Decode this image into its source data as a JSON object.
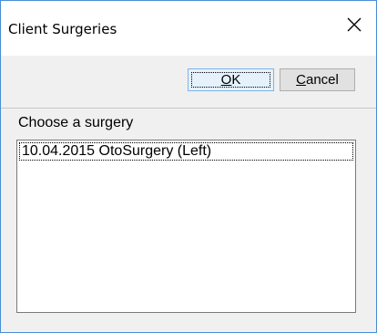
{
  "window": {
    "title": "Client Surgeries",
    "close_icon": "close-icon"
  },
  "toolbar": {
    "ok_label_mnemonic": "O",
    "ok_label_rest": "K",
    "cancel_label_mnemonic": "C",
    "cancel_label_rest": "ancel"
  },
  "content": {
    "choose_label": "Choose a surgery",
    "surgeries": [
      "10.04.2015 OtoSurgery (Left)"
    ]
  },
  "colors": {
    "window_border": "#4a8fd6",
    "ok_border": "#7eb4ea",
    "ok_background": "#e5f1fb",
    "button_background": "#e1e1e1",
    "panel_background": "#f0f0f0"
  }
}
